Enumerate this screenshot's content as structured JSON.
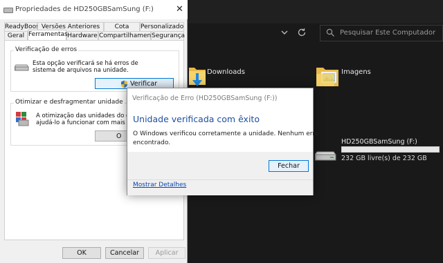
{
  "properties_dialog": {
    "title": "Propriedades de HD250GBSamSung (F:)",
    "close_glyph": "✕",
    "tabs_row1": [
      "ReadyBoost",
      "Versões Anteriores",
      "Cota",
      "Personalizado"
    ],
    "tabs_row2": [
      "Geral",
      "Ferramentas",
      "Hardware",
      "Compartilhamento",
      "Segurança"
    ],
    "active_tab": "Ferramentas",
    "error_check": {
      "group_title": "Verificação de erros",
      "line1": "Esta opção verificará se há erros de",
      "line2": "sistema de arquivos na unidade.",
      "button": "Verificar"
    },
    "optimize": {
      "group_title": "Otimizar e desfragmentar unidade",
      "line1": "A otimização das unidades do comp",
      "line2": "ajudá-lo a funcionar com mais eficiê",
      "button_partial": "O"
    },
    "buttons": {
      "ok": "OK",
      "cancel": "Cancelar",
      "apply": "Aplicar"
    }
  },
  "check_dialog": {
    "title": "Verificação de Erro (HD250GBSamSung (F:))",
    "heading": "Unidade verificada com êxito",
    "message_line1": "O Windows verificou corretamente a unidade. Nenhum erro",
    "message_line2": "encontrado.",
    "close_button": "Fechar",
    "details_link": "Mostrar Detalhes"
  },
  "explorer": {
    "search_placeholder": "Pesquisar Este Computador",
    "folders": [
      "Downloads",
      "Imagens"
    ],
    "drive": {
      "name": "HD250GBSamSung (F:)",
      "free_text": "232 GB livre(s) de 232 GB",
      "used_fraction": 0.0
    }
  },
  "colors": {
    "heading_blue": "#1e4fa0",
    "link_blue": "#0645ad",
    "accent": "#0078d7"
  }
}
